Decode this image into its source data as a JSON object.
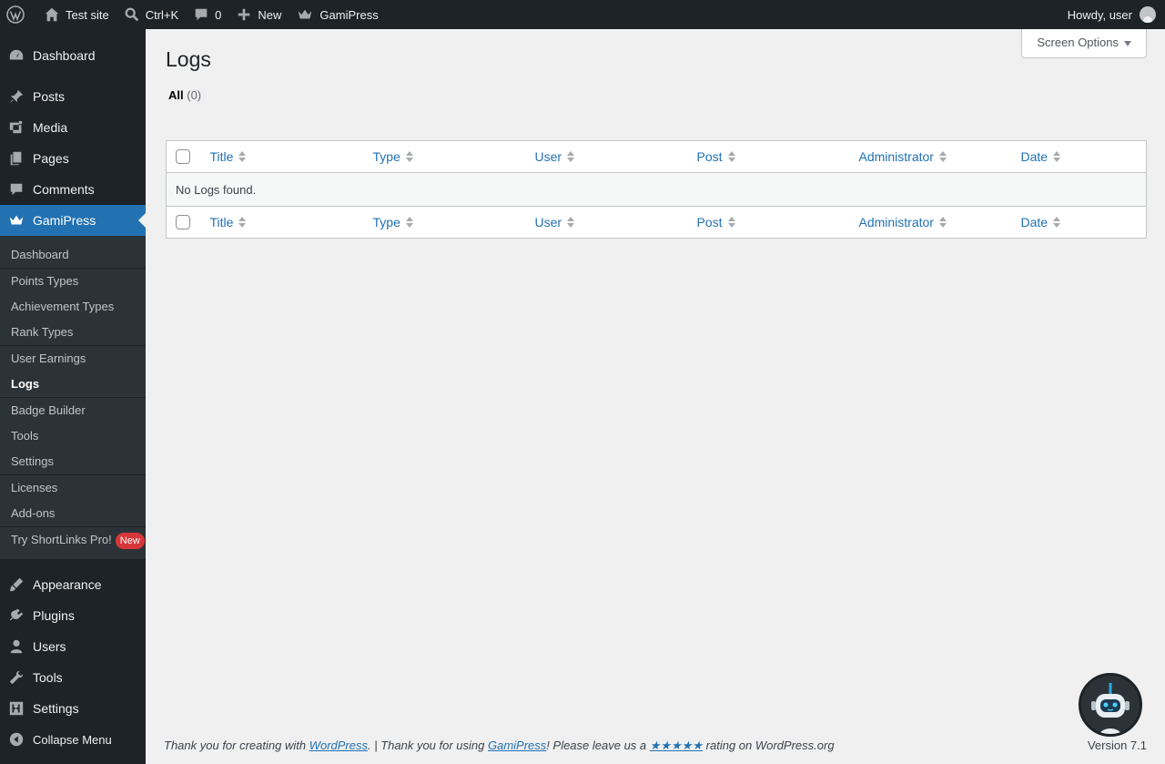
{
  "adminbar": {
    "wp_logo": "wordpress-icon",
    "site_name": "Test site",
    "search_shortcut": "Ctrl+K",
    "comments_count": "0",
    "new_label": "New",
    "gamipress_label": "GamiPress",
    "howdy": "Howdy, user"
  },
  "sidebar": {
    "dashboard": "Dashboard",
    "posts": "Posts",
    "media": "Media",
    "pages": "Pages",
    "comments": "Comments",
    "gamipress": "GamiPress",
    "gamipress_sub": {
      "dashboard": "Dashboard",
      "points_types": "Points Types",
      "achievement_types": "Achievement Types",
      "rank_types": "Rank Types",
      "user_earnings": "User Earnings",
      "logs": "Logs",
      "badge_builder": "Badge Builder",
      "tools": "Tools",
      "settings": "Settings",
      "licenses": "Licenses",
      "addons": "Add-ons",
      "try_shortlinks": "Try ShortLinks Pro!",
      "new_badge": "New"
    },
    "appearance": "Appearance",
    "plugins": "Plugins",
    "users": "Users",
    "tools": "Tools",
    "settings": "Settings",
    "collapse": "Collapse Menu"
  },
  "main": {
    "screen_options": "Screen Options",
    "title": "Logs",
    "filter_all": "All",
    "filter_all_count": "(0)",
    "columns": [
      "Title",
      "Type",
      "User",
      "Post",
      "Administrator",
      "Date"
    ],
    "empty_message": "No Logs found."
  },
  "footer": {
    "text1": "Thank you for creating with ",
    "wordpress_link": "WordPress",
    "text2": ". | Thank you for using ",
    "gamipress_link": "GamiPress",
    "text3": "! Please leave us a ",
    "stars_link": "★★★★★",
    "text4": " rating on WordPress.org",
    "version": "Version 7.1"
  },
  "colors": {
    "adminbar_bg": "#1d2327",
    "sidebar_current": "#2271b1",
    "link": "#2271b1",
    "badge_new": "#d63638"
  }
}
